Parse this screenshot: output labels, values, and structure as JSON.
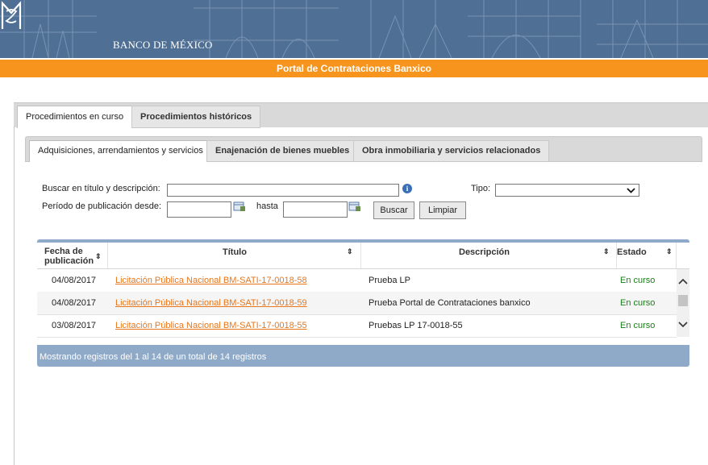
{
  "header": {
    "logo_text": "BANCO DE MÉXICO",
    "logo_mark": "BM monogram",
    "portal_title": "Portal de Contrataciones Banxico"
  },
  "outer_tabs": [
    {
      "label": "Procedimientos en curso",
      "active": true
    },
    {
      "label": "Procedimientos históricos",
      "active": false
    }
  ],
  "inner_tabs": [
    {
      "label": "Adquisiciones, arrendamientos y servicios",
      "active": true
    },
    {
      "label": "Enajenación de bienes muebles",
      "active": false
    },
    {
      "label": "Obra inmobiliaria y servicios relacionados",
      "active": false
    }
  ],
  "form": {
    "search_label": "Buscar en título y descripción:",
    "search_value": "",
    "info_icon": "info-icon",
    "tipo_label": "Tipo:",
    "tipo_value": "",
    "period_label": "Período de publicación desde:",
    "desde_value": "",
    "hasta_label": "hasta",
    "hasta_value": "",
    "buscar_label": "Buscar",
    "limpiar_label": "Limpiar",
    "calendar_icon": "calendar-icon"
  },
  "table": {
    "columns": [
      {
        "label": "Fecha de\npublicación",
        "sortable": true
      },
      {
        "label": "Título",
        "sortable": true
      },
      {
        "label": "Descripción",
        "sortable": true
      },
      {
        "label": "Estado",
        "sortable": true
      }
    ],
    "rows": [
      {
        "fecha": "04/08/2017",
        "titulo": "Licitación Pública Nacional BM-SATI-17-0018-58",
        "descripcion": "Prueba LP",
        "estado": "En curso"
      },
      {
        "fecha": "04/08/2017",
        "titulo": "Licitación Pública Nacional BM-SATI-17-0018-59",
        "descripcion": "Prueba Portal de Contrataciones banxico",
        "estado": "En curso"
      },
      {
        "fecha": "03/08/2017",
        "titulo": "Licitación Pública Nacional BM-SATI-17-0018-55",
        "descripcion": "Pruebas LP 17-0018-55",
        "estado": "En curso"
      }
    ],
    "footer": "Mostrando registros del 1 al 14 de un total de 14 registros"
  },
  "colors": {
    "banner": "#4f6f95",
    "accent_orange": "#f7941d",
    "link_orange": "#e8761a",
    "status_green": "#1a7d1a",
    "grid_bar": "#8fa9c8"
  }
}
